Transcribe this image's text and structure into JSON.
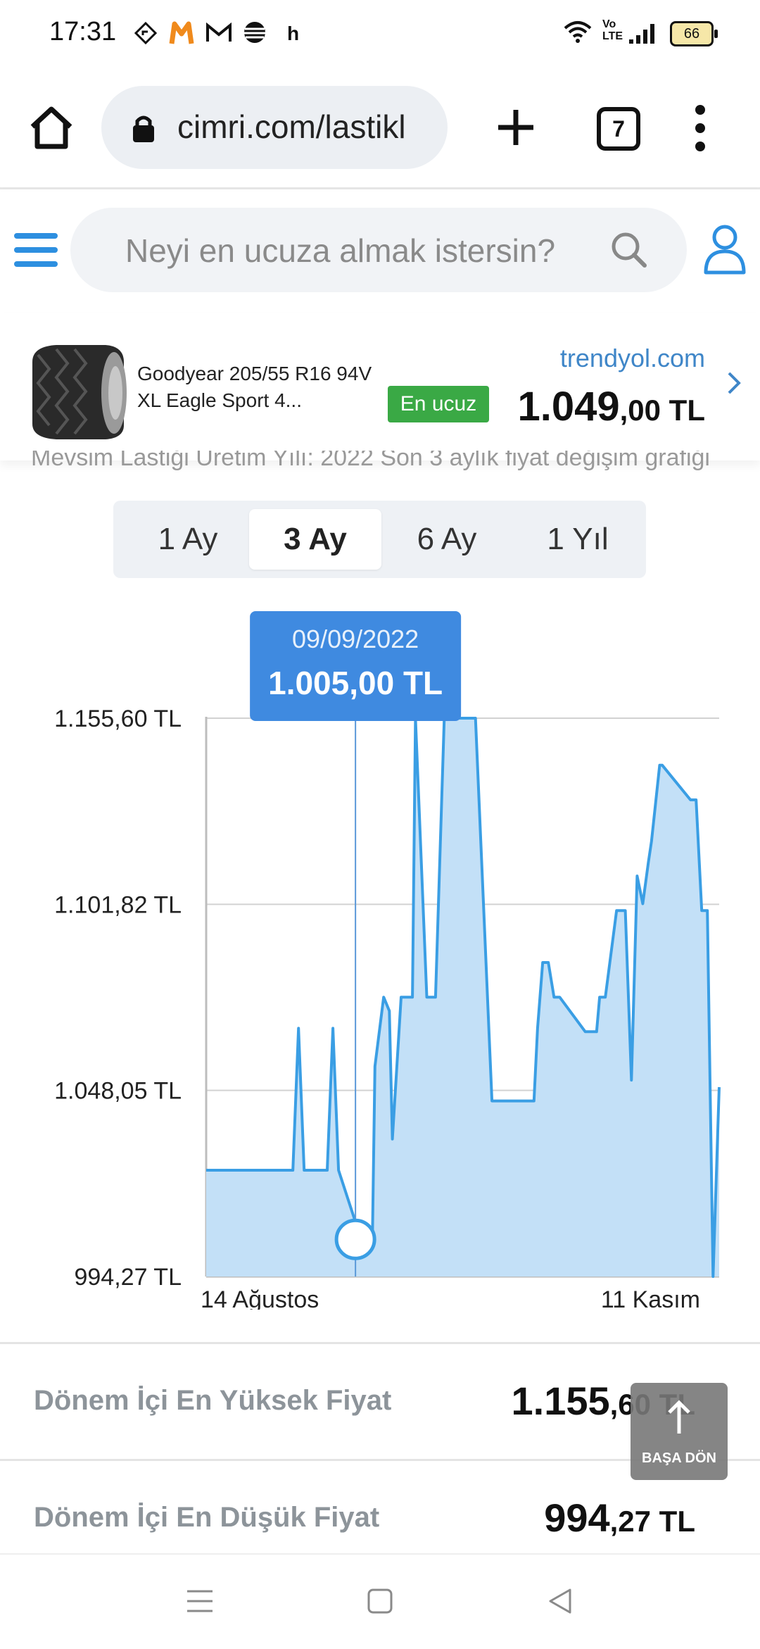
{
  "status_bar": {
    "time": "17:31",
    "notif_letter": "h",
    "battery": "66",
    "icons": [
      "navigation-icon",
      "m-app-icon",
      "gmail-icon",
      "globe-app-icon",
      "wifi-icon",
      "volte-icon",
      "signal-icon",
      "battery-icon"
    ]
  },
  "browser": {
    "url": "cimri.com/lastikl",
    "tab_count": "7",
    "icons": [
      "home-icon",
      "lock-icon",
      "plus-icon",
      "more-vert-icon"
    ]
  },
  "site_header": {
    "search_placeholder": "Neyi en ucuza almak istersin?",
    "icons": [
      "hamburger-icon",
      "search-icon",
      "user-icon"
    ]
  },
  "product": {
    "name": "Goodyear 205/55 R16 94V XL Eagle Sport 4...",
    "badge": "En ucuz",
    "seller": "trendyol.com",
    "price_int": "1.049",
    "price_dec": ",00 TL",
    "cut_text": "Mevsim Lastiği Üretim Yılı: 2022 Son 3 aylık fiyat değişim grafiği"
  },
  "period_tabs": [
    {
      "label": "1 Ay",
      "active": false
    },
    {
      "label": "3 Ay",
      "active": true
    },
    {
      "label": "6 Ay",
      "active": false
    },
    {
      "label": "1 Yıl",
      "active": false
    }
  ],
  "chart_data": {
    "type": "area",
    "title": "",
    "xlabel": "",
    "ylabel": "",
    "x_tick_labels": [
      "14 Ağustos",
      "11 Kasım"
    ],
    "y_tick_labels": [
      "1.155,60 TL",
      "1.101,82 TL",
      "1.048,05 TL",
      "994,27 TL"
    ],
    "y_ticks": [
      1155.6,
      1101.82,
      1048.05,
      994.27
    ],
    "ylim": [
      994.27,
      1155.6
    ],
    "xlim": [
      0,
      100
    ],
    "grid": true,
    "fill_color": "#c3e0f7",
    "line_color": "#3a9ee4",
    "tooltip": {
      "date": "09/09/2022",
      "price": "1.005,00 TL",
      "x": 29.1,
      "y": 1005.0
    },
    "x": [
      0,
      16.9,
      18.0,
      19.1,
      23.6,
      24.7,
      25.8,
      30.2,
      31.8,
      32.4,
      32.9,
      34.6,
      35.7,
      36.3,
      38.0,
      40.2,
      40.8,
      43.0,
      44.7,
      46.4,
      47.5,
      52.5,
      55.7,
      63.9,
      64.6,
      65.6,
      66.7,
      67.8,
      68.9,
      73.9,
      74.5,
      76.1,
      76.7,
      77.8,
      80.0,
      80.6,
      81.1,
      81.7,
      82.9,
      84.0,
      85.1,
      86.2,
      86.8,
      88.4,
      88.9,
      94.4,
      95.5,
      96.6,
      97.7,
      98.8,
      100
    ],
    "y": [
      1025.0,
      1025.0,
      1066.0,
      1025.0,
      1025.0,
      1066.0,
      1025.0,
      1005.0,
      1005.0,
      1005.0,
      1055.0,
      1075.0,
      1071.0,
      1034.0,
      1075.0,
      1075.0,
      1155.6,
      1075.0,
      1075.0,
      1155.6,
      1155.6,
      1155.6,
      1045.0,
      1045.0,
      1066.0,
      1085.0,
      1085.0,
      1075.0,
      1075.0,
      1065.0,
      1065.0,
      1065.0,
      1075.0,
      1075.0,
      1100.0,
      1100.0,
      1100.0,
      1100.0,
      1051.0,
      1110.0,
      1102.0,
      1114.0,
      1120.0,
      1142.0,
      1142.0,
      1132.0,
      1132.0,
      1100.0,
      1100.0,
      994.27,
      1049.0
    ]
  },
  "stats": [
    {
      "label": "Dönem İçi En Yüksek Fiyat",
      "int": "1.155",
      "dec": ",60 TL"
    },
    {
      "label": "Dönem İçi En Düşük Fiyat",
      "int": "994",
      "dec": ",27 TL"
    }
  ],
  "back_to_top": {
    "label": "BAŞA DÖN"
  },
  "nav_bar": {
    "icons": [
      "recents-icon",
      "home-nav-icon",
      "back-nav-icon"
    ]
  }
}
